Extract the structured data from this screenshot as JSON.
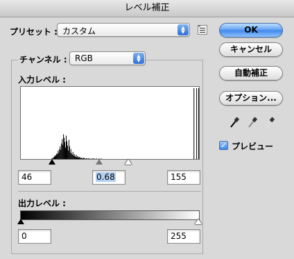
{
  "window": {
    "title": "レベル補正"
  },
  "preset": {
    "label": "プリセット :",
    "value": "カスタム"
  },
  "channel": {
    "label": "チャンネル :",
    "value": "RGB"
  },
  "input_levels": {
    "label": "入力レベル :",
    "black": "46",
    "gamma": "0.68",
    "white": "155"
  },
  "output_levels": {
    "label": "出力レベル :",
    "black": "0",
    "white": "255"
  },
  "buttons": {
    "ok": "OK",
    "cancel": "キャンセル",
    "auto": "自動補正",
    "options": "オプション..."
  },
  "preview": {
    "label": "プレビュー",
    "checked": true,
    "check_glyph": "✓"
  },
  "icons": {
    "stepper_up": "▲",
    "stepper_down": "▼",
    "preset_menu": "list-icon",
    "eyedroppers": [
      "black-eyedropper-icon",
      "gray-eyedropper-icon",
      "white-eyedropper-icon"
    ]
  },
  "colors": {
    "accent": "#3d86ea",
    "dialog_bg": "#d9d9d9"
  },
  "histogram": [
    0,
    0,
    0,
    0,
    0,
    0,
    0,
    0,
    0,
    0,
    0,
    0,
    0,
    0,
    0,
    0,
    0,
    0,
    0,
    0,
    0,
    0,
    0,
    0,
    0,
    0,
    0,
    0,
    0,
    0,
    0,
    0,
    0,
    0,
    0,
    0,
    0,
    0,
    0,
    0,
    0,
    0,
    0,
    0,
    0,
    0,
    1,
    1,
    2,
    3,
    5,
    4,
    6,
    8,
    7,
    12,
    9,
    14,
    18,
    13,
    22,
    28,
    20,
    35,
    30,
    24,
    16,
    33,
    25,
    19,
    12,
    27,
    18,
    9,
    14,
    8,
    6,
    10,
    5,
    7,
    4,
    3,
    6,
    2,
    4,
    3,
    2,
    3,
    2,
    1,
    2,
    1,
    1,
    2,
    1,
    1,
    0,
    1,
    1,
    0,
    1,
    0,
    1,
    0,
    0,
    1,
    0,
    1,
    0,
    1,
    0,
    0,
    1,
    0,
    0,
    0,
    1,
    0,
    0,
    1,
    0,
    0,
    0,
    0,
    0,
    0,
    0,
    0,
    0,
    0,
    0,
    0,
    0,
    0,
    0,
    0,
    0,
    0,
    0,
    0,
    0,
    0,
    0,
    0,
    0,
    0,
    0,
    0,
    0,
    0,
    0,
    0,
    0,
    0,
    0,
    0,
    0,
    0,
    0,
    0,
    0,
    0,
    0,
    0,
    0,
    0,
    0,
    0,
    0,
    0,
    0,
    0,
    0,
    0,
    0,
    0,
    0,
    0,
    0,
    0,
    0,
    0,
    0,
    0,
    0,
    0,
    0,
    0,
    0,
    0,
    0,
    0,
    0,
    0,
    0,
    0,
    0,
    0,
    0,
    0,
    0,
    0,
    0,
    0,
    0,
    0,
    0,
    0,
    0,
    0,
    0,
    0,
    0,
    0,
    0,
    0,
    0,
    0,
    0,
    0,
    0,
    0,
    0,
    0,
    0,
    0,
    0,
    0,
    0,
    0,
    0,
    0,
    0,
    0,
    0,
    0,
    0,
    0,
    0,
    0,
    0,
    0,
    0,
    0,
    0,
    0,
    0,
    0,
    0,
    0,
    0,
    0,
    0,
    0,
    0,
    0,
    0,
    100,
    0,
    0,
    0,
    100,
    0,
    0,
    100
  ]
}
